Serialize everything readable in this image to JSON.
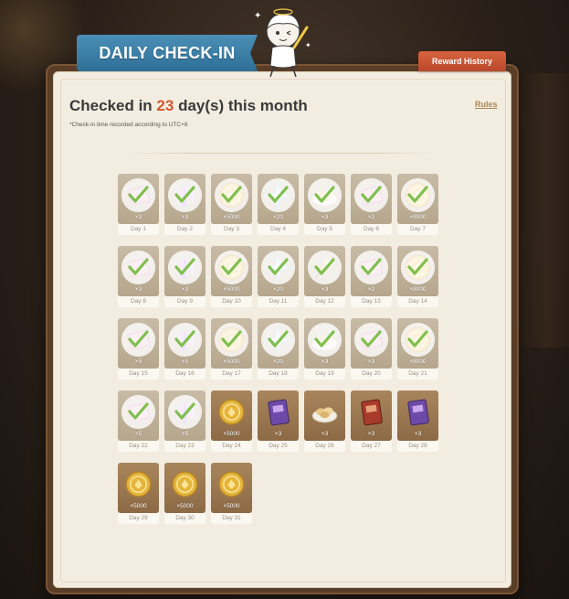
{
  "header": {
    "title": "DAILY CHECK-IN",
    "reward_history": "Reward History",
    "rules": "Rules"
  },
  "summary": {
    "prefix": "Checked in ",
    "days": "23",
    "suffix": " day(s) this month",
    "note": "*Check-in time recorded according to UTC+8"
  },
  "colors": {
    "banner": "#3a7ea8",
    "reward_button": "#c8552f",
    "accent_count": "#d3572e",
    "claimed_tile": "#bfb19a",
    "unclaimed_tile": "#9c7a52"
  },
  "days": [
    {
      "label": "Day 1",
      "qty": "×3",
      "item": "hero-wit-icon",
      "claimed": true
    },
    {
      "label": "Day 2",
      "qty": "×3",
      "item": "enhancement-ore-icon",
      "claimed": true
    },
    {
      "label": "Day 3",
      "qty": "×5000",
      "item": "mora-icon",
      "claimed": true
    },
    {
      "label": "Day 4",
      "qty": "×20",
      "item": "primogem-icon",
      "claimed": true
    },
    {
      "label": "Day 5",
      "qty": "×3",
      "item": "food-dish-icon",
      "claimed": true
    },
    {
      "label": "Day 6",
      "qty": "×2",
      "item": "hero-wit-icon",
      "claimed": true
    },
    {
      "label": "Day 7",
      "qty": "×8000",
      "item": "mora-icon",
      "claimed": true
    },
    {
      "label": "Day 8",
      "qty": "×3",
      "item": "hero-wit-icon",
      "claimed": true
    },
    {
      "label": "Day 9",
      "qty": "×3",
      "item": "enhancement-ore-icon",
      "claimed": true
    },
    {
      "label": "Day 10",
      "qty": "×5000",
      "item": "mora-icon",
      "claimed": true
    },
    {
      "label": "Day 11",
      "qty": "×20",
      "item": "primogem-icon",
      "claimed": true
    },
    {
      "label": "Day 12",
      "qty": "×3",
      "item": "food-skewer-icon",
      "claimed": true
    },
    {
      "label": "Day 13",
      "qty": "×2",
      "item": "hero-wit-icon",
      "claimed": true
    },
    {
      "label": "Day 14",
      "qty": "×8000",
      "item": "mora-icon",
      "claimed": true
    },
    {
      "label": "Day 15",
      "qty": "×5",
      "item": "hero-wit-icon",
      "claimed": true
    },
    {
      "label": "Day 16",
      "qty": "×5",
      "item": "enhancement-ore-icon",
      "claimed": true
    },
    {
      "label": "Day 17",
      "qty": "×5000",
      "item": "mora-icon",
      "claimed": true
    },
    {
      "label": "Day 18",
      "qty": "×20",
      "item": "primogem-icon",
      "claimed": true
    },
    {
      "label": "Day 19",
      "qty": "×3",
      "item": "food-dish-icon",
      "claimed": true
    },
    {
      "label": "Day 20",
      "qty": "×3",
      "item": "hero-wit-icon",
      "claimed": true
    },
    {
      "label": "Day 21",
      "qty": "×8000",
      "item": "mora-icon",
      "claimed": true
    },
    {
      "label": "Day 22",
      "qty": "×5",
      "item": "hero-wit-icon",
      "claimed": true
    },
    {
      "label": "Day 23",
      "qty": "×5",
      "item": "enhancement-ore-icon",
      "claimed": true
    },
    {
      "label": "Day 24",
      "qty": "×5000",
      "item": "mora-icon",
      "claimed": false
    },
    {
      "label": "Day 25",
      "qty": "×3",
      "item": "purple-book-icon",
      "claimed": false
    },
    {
      "label": "Day 26",
      "qty": "×3",
      "item": "food-dish-icon",
      "claimed": false
    },
    {
      "label": "Day 27",
      "qty": "×3",
      "item": "red-book-icon",
      "claimed": false
    },
    {
      "label": "Day 28",
      "qty": "×3",
      "item": "purple-book-icon",
      "claimed": false
    },
    {
      "label": "Day 29",
      "qty": "×5000",
      "item": "mora-icon",
      "claimed": false
    },
    {
      "label": "Day 30",
      "qty": "×5000",
      "item": "mora-icon",
      "claimed": false
    },
    {
      "label": "Day 31",
      "qty": "×5000",
      "item": "mora-icon",
      "claimed": false
    }
  ]
}
